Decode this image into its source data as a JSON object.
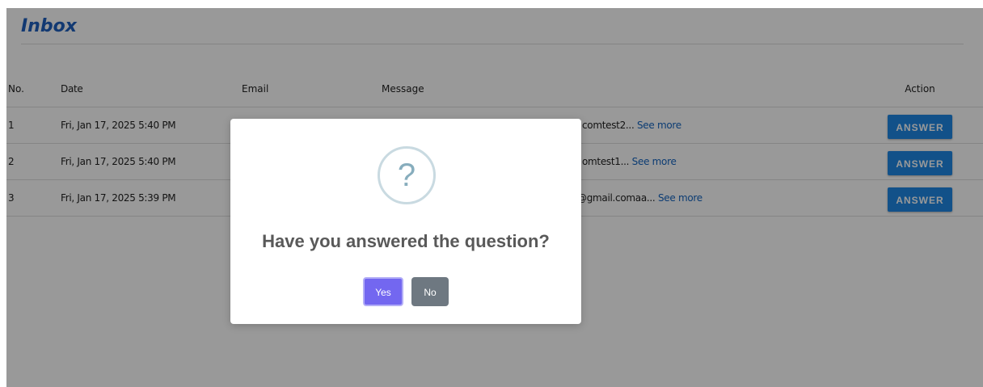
{
  "page": {
    "title": "Inbox"
  },
  "table": {
    "headers": {
      "no": "No.",
      "date": "Date",
      "email": "Email",
      "message": "Message",
      "action": "Action"
    },
    "rows": [
      {
        "no": "1",
        "date": "Fri, Jan 17, 2025 5:40 PM",
        "message_visible": "comtest2...",
        "see_more": "See more",
        "action": "ANSWER"
      },
      {
        "no": "2",
        "date": "Fri, Jan 17, 2025 5:40 PM",
        "message_visible": "omtest1...",
        "see_more": "See more",
        "action": "ANSWER"
      },
      {
        "no": "3",
        "date": "Fri, Jan 17, 2025 5:39 PM",
        "message_visible": "@gmail.comaa...",
        "see_more": "See more",
        "action": "ANSWER"
      }
    ]
  },
  "modal": {
    "icon": "?",
    "title": "Have you answered the question?",
    "confirm_label": "Yes",
    "cancel_label": "No"
  },
  "colors": {
    "title": "#1f5fbf",
    "answer_button": "#1e88e5",
    "confirm_button": "#7367f0",
    "cancel_button": "#6e7881",
    "link": "#1565c0"
  }
}
